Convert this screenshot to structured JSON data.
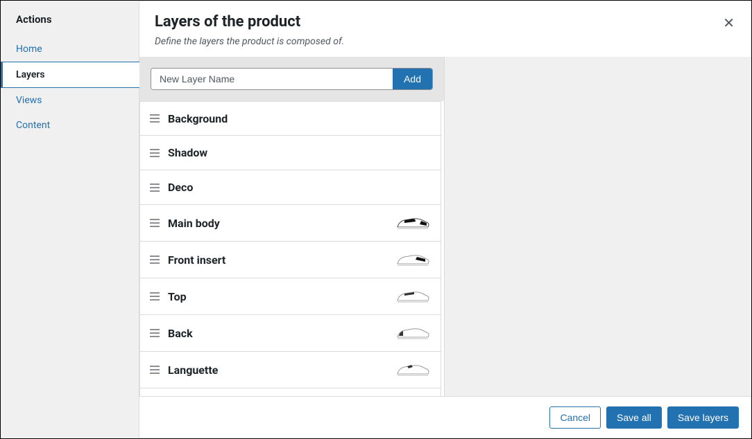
{
  "sidebar": {
    "title": "Actions",
    "items": [
      {
        "label": "Home",
        "active": false
      },
      {
        "label": "Layers",
        "active": true
      },
      {
        "label": "Views",
        "active": false
      },
      {
        "label": "Content",
        "active": false
      }
    ]
  },
  "header": {
    "title": "Layers of the product",
    "subtitle": "Define the layers the product is composed of."
  },
  "addLayer": {
    "placeholder": "New Layer Name",
    "button": "Add"
  },
  "layers": [
    {
      "name": "Background",
      "hasThumb": false
    },
    {
      "name": "Shadow",
      "hasThumb": false
    },
    {
      "name": "Deco",
      "hasThumb": false
    },
    {
      "name": "Main body",
      "hasThumb": true,
      "variant": "mainbody"
    },
    {
      "name": "Front insert",
      "hasThumb": true,
      "variant": "frontinsert"
    },
    {
      "name": "Top",
      "hasThumb": true,
      "variant": "top"
    },
    {
      "name": "Back",
      "hasThumb": true,
      "variant": "back"
    },
    {
      "name": "Languette",
      "hasThumb": true,
      "variant": "languette"
    }
  ],
  "footer": {
    "cancel": "Cancel",
    "saveAll": "Save all",
    "saveLayers": "Save layers"
  }
}
